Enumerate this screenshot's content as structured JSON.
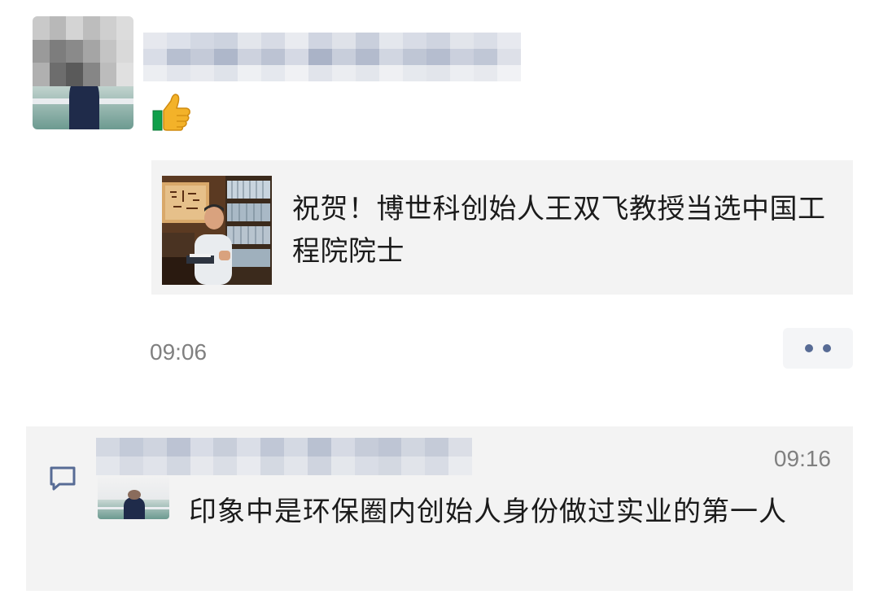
{
  "post": {
    "reaction_icon": "thumbs-up-icon",
    "link": {
      "title": "祝贺！博世科创始人王双飞教授当选中国工程院院士"
    },
    "time": "09:06",
    "more_icon": "more-dots-icon"
  },
  "comment": {
    "icon": "comment-bubble-icon",
    "time": "09:16",
    "text": "印象中是环保圈内创始人身份做过实业的第一人"
  },
  "colors": {
    "accent": "#576b95",
    "card_background": "#f3f3f3",
    "muted_text": "#808080"
  }
}
